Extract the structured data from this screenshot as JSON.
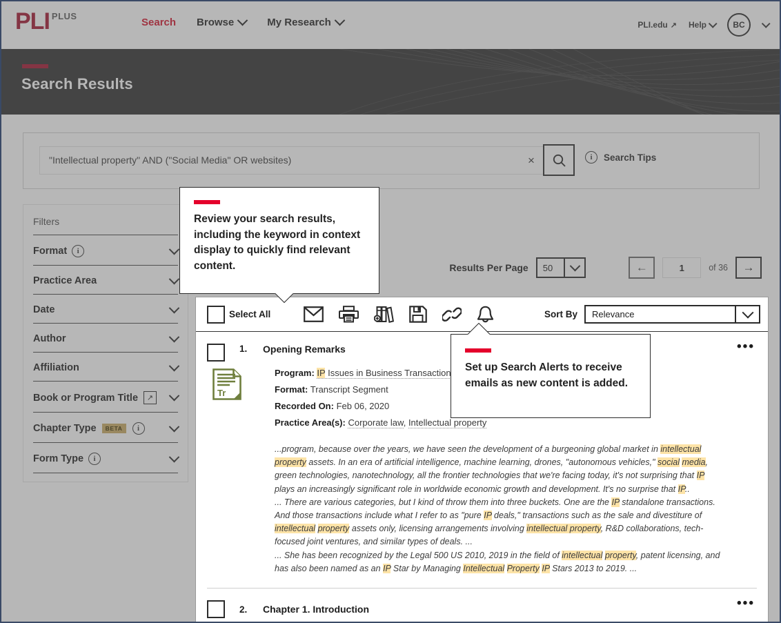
{
  "brand": {
    "logo_main": "PLI",
    "logo_sub": "PLUS",
    "accent_red": "#a3132f",
    "tooltip_red": "#e4002b"
  },
  "topnav": {
    "items": [
      {
        "label": "Search",
        "icon": "",
        "active": true
      },
      {
        "label": "Browse",
        "icon": "chevron-down-icon",
        "active": false
      },
      {
        "label": "My Research",
        "icon": "chevron-down-icon",
        "active": false
      }
    ],
    "right": {
      "pli_edu": "PLI.edu",
      "external_arrow": "↗",
      "help": "Help",
      "avatar_initials": "BC"
    }
  },
  "hero": {
    "title": "Search Results"
  },
  "search": {
    "query": "\"Intellectual property\" AND (\"Social Media\" OR websites)",
    "clear_label": "×",
    "search_icon": "search-icon",
    "tips_label": "Search Tips",
    "info_icon": "i"
  },
  "filters": {
    "heading": "Filters",
    "items": [
      {
        "label": "Format",
        "info": true,
        "beta": false,
        "external": false
      },
      {
        "label": "Practice Area",
        "info": false,
        "beta": false,
        "external": false
      },
      {
        "label": "Date",
        "info": false,
        "beta": false,
        "external": false
      },
      {
        "label": "Author",
        "info": false,
        "beta": false,
        "external": false
      },
      {
        "label": "Affiliation",
        "info": false,
        "beta": false,
        "external": false
      },
      {
        "label": "Book or Program Title",
        "info": false,
        "beta": false,
        "external": true
      },
      {
        "label": "Chapter Type",
        "info": true,
        "beta": true,
        "beta_label": "BETA",
        "external": false
      },
      {
        "label": "Form Type",
        "info": true,
        "beta": false,
        "external": false
      }
    ]
  },
  "results_meta": {
    "per_page_label": "Results Per Page",
    "per_page_value": "50",
    "prev_arrow": "←",
    "next_arrow": "→",
    "page_value": "1",
    "page_of": "of 36"
  },
  "toolbar": {
    "select_all": "Select All",
    "icons": [
      {
        "name": "email-icon"
      },
      {
        "name": "print-icon"
      },
      {
        "name": "add-to-binder-icon"
      },
      {
        "name": "save-icon"
      },
      {
        "name": "link-icon"
      },
      {
        "name": "bell-alert-icon"
      }
    ],
    "sort_label": "Sort By",
    "sort_value": "Relevance"
  },
  "results": [
    {
      "number": "1.",
      "title": "Opening Remarks",
      "doc_icon_label": "Tr",
      "meta": [
        {
          "label": "Program:",
          "value": "IP Issues in Business Transactions",
          "link": true,
          "highlight": "IP"
        },
        {
          "label": "Format:",
          "value": "Transcript Segment",
          "link": false
        },
        {
          "label": "Recorded On:",
          "value": "Feb 06, 2020",
          "link": false
        },
        {
          "label": "Practice Area(s):",
          "value": "Corporate law, Intellectual property",
          "link": true
        }
      ],
      "snippet_paragraphs": [
        "...program, because over the years, we have seen the development of a burgeoning global market in |intellectual property| assets. In an era of artificial intelligence, machine learning, drones, \"autonomous vehicles,\" |social| |media|, green technologies, nanotechnology, all the frontier technologies that we're facing today, it's not surprising that |IP| plays an increasingly significant role in worldwide economic growth and development. It's no surprise that |IP|..",
        "... There are various categories, but I kind of throw them into three buckets. One are the |IP| standalone transactions. And those transactions include what I refer to as \"pure |IP| deals,\" transactions such as the sale and divestiture of |intellectual| |property| assets only, licensing arrangements involving |intellectual property|, R&D collaborations, tech-focused joint ventures, and similar types of deals. ...",
        "... She has been recognized by the Legal 500 US 2010, 2019 in the field of |intellectual| |property|, patent licensing, and has also been named as an |IP| Star by Managing |Intellectual| |Property| |IP| Stars 2013 to 2019. ..."
      ],
      "overflow_menu": "•••"
    },
    {
      "number": "2.",
      "title": "Chapter 1. Introduction",
      "overflow_menu": "•••"
    }
  ],
  "tooltips": [
    {
      "text": "Review your search results, including the keyword in context display to quickly find relevant content.",
      "pointer": "down"
    },
    {
      "text": "Set up Search Alerts to receive emails as new content is added.",
      "pointer": "up"
    }
  ]
}
